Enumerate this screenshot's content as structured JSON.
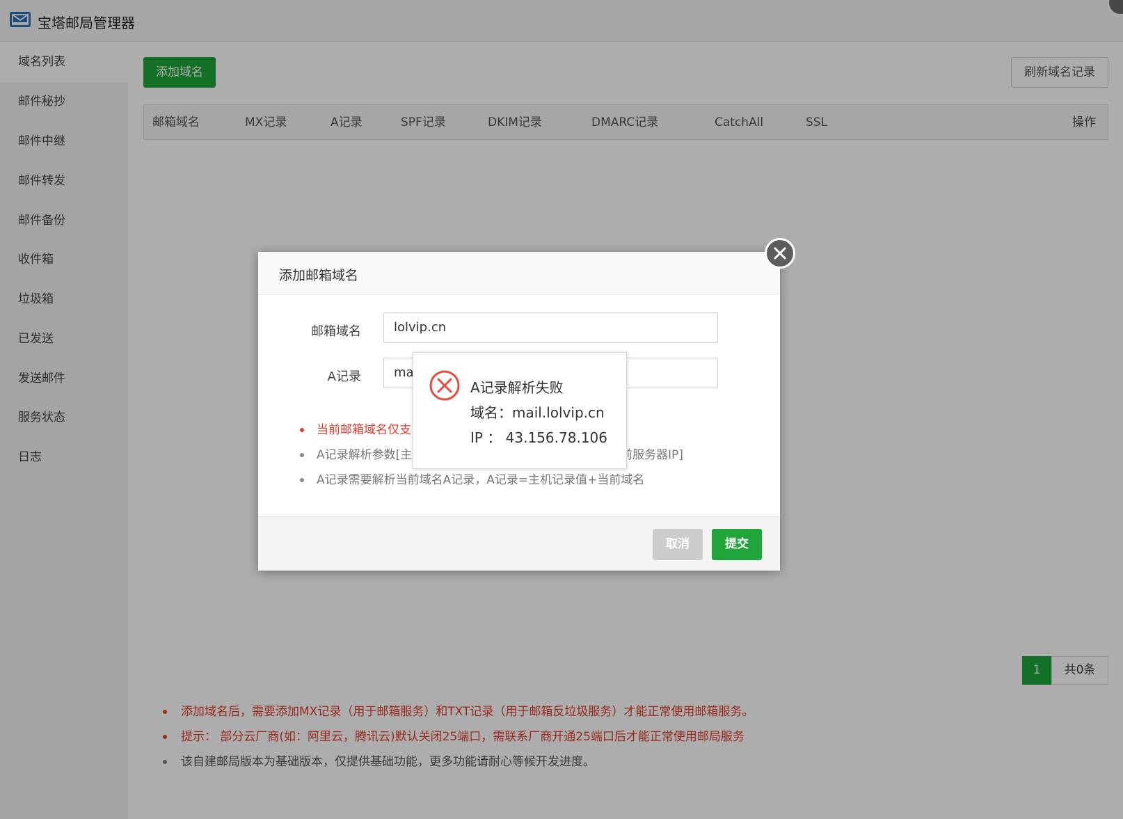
{
  "app": {
    "title": "宝塔邮局管理器",
    "icon": "mail-icon"
  },
  "sidebar": {
    "items": [
      {
        "label": "域名列表",
        "active": true
      },
      {
        "label": "邮件秘抄"
      },
      {
        "label": "邮件中继"
      },
      {
        "label": "邮件转发"
      },
      {
        "label": "邮件备份"
      },
      {
        "label": "收件箱"
      },
      {
        "label": "垃圾箱"
      },
      {
        "label": "已发送"
      },
      {
        "label": "发送邮件"
      },
      {
        "label": "服务状态"
      },
      {
        "label": "日志"
      }
    ]
  },
  "toolbar": {
    "add_label": "添加域名",
    "refresh_label": "刷新域名记录"
  },
  "table": {
    "columns": [
      "邮箱域名",
      "MX记录",
      "A记录",
      "SPF记录",
      "DKIM记录",
      "DMARC记录",
      "CatchAll",
      "SSL",
      "操作"
    ],
    "rows": []
  },
  "pagination": {
    "current": "1",
    "total": "共0条"
  },
  "tips": [
    {
      "text": "添加域名后，需要添加MX记录（用于邮箱服务）和TXT记录（用于邮箱反垃圾服务）才能正常使用邮箱服务。",
      "color": "red"
    },
    {
      "text": "提示： 部分云厂商(如：阿里云，腾讯云)默认关闭25端口，需联系厂商开通25端口后才能正常使用邮局服务",
      "color": "red"
    },
    {
      "text": "该自建邮局版本为基础版本，仅提供基础功能，更多功能请耐心等候开发进度。",
      "color": "gray"
    }
  ],
  "dialog": {
    "title": "添加邮箱域名",
    "domain_label": "邮箱域名",
    "domain_value": "lolvip.cn",
    "a_label": "A记录",
    "a_value": "mai",
    "notes": [
      {
        "text": "当前邮箱域名仅支",
        "color": "red"
      },
      {
        "text": "A记录解析参数[主",
        "tail": "当前服务器IP]",
        "color": "gray"
      },
      {
        "text": "A记录需要解析当前域名A记录，A记录=主机记录值+当前域名",
        "color": "gray"
      }
    ],
    "cancel_label": "取消",
    "submit_label": "提交"
  },
  "toast": {
    "icon": "error-icon",
    "title": "A记录解析失败",
    "domain_line": "域名：mail.lolvip.cn",
    "ip_line": "IP ： 43.156.78.106"
  },
  "colors": {
    "primary": "#20a53a",
    "danger": "#e03e2d",
    "brand_icon": "#2f6fb5"
  }
}
